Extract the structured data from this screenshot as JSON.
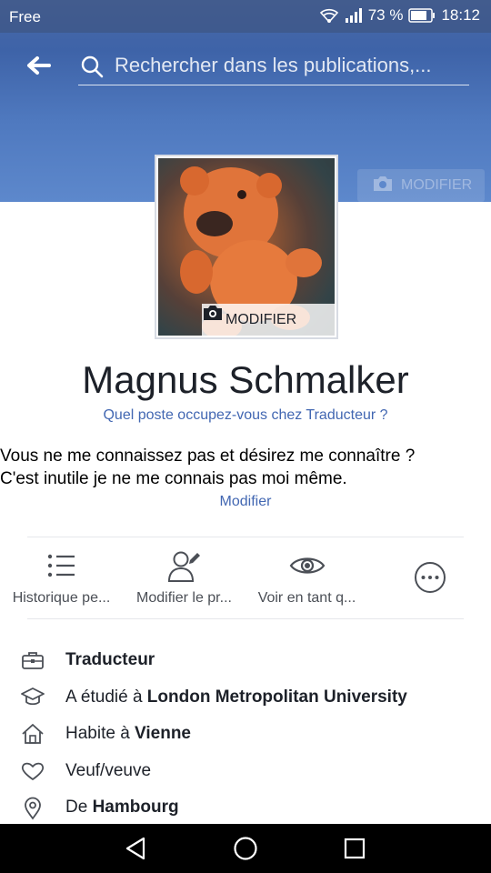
{
  "status_bar": {
    "carrier": "Free",
    "battery": "73 %",
    "time": "18:12"
  },
  "header": {
    "search_placeholder": "Rechercher dans les publications,...",
    "cover_edit_label": "MODIFIER"
  },
  "profile": {
    "photo_edit_label": "MODIFIER",
    "name": "Magnus Schmalker",
    "job_prompt": "Quel poste occupez-vous chez Traducteur ?",
    "bio_line1": "Vous ne me connaissez pas et désirez me connaître ?",
    "bio_line2": "C'est inutile je ne me connais pas moi même.",
    "bio_edit_label": "Modifier"
  },
  "actions": [
    {
      "label": "Historique pe...",
      "icon": "list-icon"
    },
    {
      "label": "Modifier le pr...",
      "icon": "edit-profile-icon"
    },
    {
      "label": "Voir en tant q...",
      "icon": "eye-icon"
    },
    {
      "label": "",
      "icon": "more-icon"
    }
  ],
  "about": [
    {
      "icon": "briefcase-icon",
      "prefix": "",
      "bold": "Traducteur"
    },
    {
      "icon": "graduation-cap-icon",
      "prefix": "A étudié à ",
      "bold": "London Metropolitan University"
    },
    {
      "icon": "home-icon",
      "prefix": "Habite à ",
      "bold": "Vienne"
    },
    {
      "icon": "heart-icon",
      "prefix": "Veuf/veuve",
      "bold": ""
    },
    {
      "icon": "location-pin-icon",
      "prefix": "De ",
      "bold": "Hambourg"
    }
  ],
  "colors": {
    "accent": "#4267b2",
    "cover": "#4f79bf"
  }
}
